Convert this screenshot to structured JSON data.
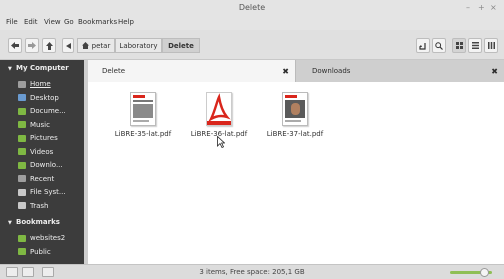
{
  "window": {
    "title": "Delete",
    "controls": [
      "–",
      "+",
      "×"
    ]
  },
  "menu": [
    "File",
    "Edit",
    "View",
    "Go",
    "Bookmarks",
    "Help"
  ],
  "toolbar": {
    "breadcrumbs": [
      "petar",
      "Laboratory",
      "Delete"
    ],
    "active_crumb": "Delete"
  },
  "sidebar": {
    "computer_header": "My Computer",
    "computer_items": [
      {
        "label": "Home",
        "icon": "home-icon",
        "color": "#9e9e9e"
      },
      {
        "label": "Desktop",
        "icon": "desktop-icon",
        "color": "#6a9bd1"
      },
      {
        "label": "Docume...",
        "icon": "folder-icon",
        "color": "#7fb843"
      },
      {
        "label": "Music",
        "icon": "folder-icon",
        "color": "#7fb843"
      },
      {
        "label": "Pictures",
        "icon": "folder-icon",
        "color": "#7fb843"
      },
      {
        "label": "Videos",
        "icon": "folder-icon",
        "color": "#7fb843"
      },
      {
        "label": "Downlo...",
        "icon": "folder-icon",
        "color": "#7fb843"
      },
      {
        "label": "Recent",
        "icon": "clock-icon",
        "color": "#9e9e9e"
      },
      {
        "label": "File Syst...",
        "icon": "drive-icon",
        "color": "#c8c8c8"
      },
      {
        "label": "Trash",
        "icon": "trash-icon",
        "color": "#c8c8c8"
      }
    ],
    "bookmarks_header": "Bookmarks",
    "bookmark_items": [
      {
        "label": "websites2",
        "icon": "folder-icon",
        "color": "#7fb843"
      },
      {
        "label": "Public",
        "icon": "folder-icon",
        "color": "#7fb843"
      }
    ]
  },
  "tabs": [
    {
      "label": "Delete",
      "active": true
    },
    {
      "label": "Downloads",
      "active": false
    }
  ],
  "files": [
    {
      "name": "LiBRE-35-lat.pdf",
      "thumb": "magazine-cover"
    },
    {
      "name": "LiBRE-36-lat.pdf",
      "thumb": "pdf-icon"
    },
    {
      "name": "LiBRE-37-lat.pdf",
      "thumb": "magazine-cover"
    }
  ],
  "status": {
    "text": "3 items, Free space: 205,1 GB"
  },
  "colors": {
    "accent_green": "#8fbf55",
    "sidebar_bg": "#3c3c3c",
    "pdf_red": "#d9261c"
  }
}
